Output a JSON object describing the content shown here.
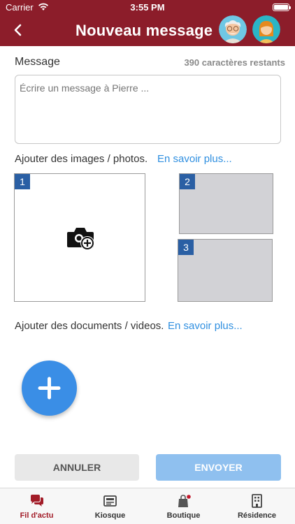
{
  "status_bar": {
    "carrier": "Carrier",
    "time": "3:55 PM"
  },
  "header": {
    "title": "Nouveau message",
    "back_icon": "chevron-left-icon",
    "background": "#8c1d2a"
  },
  "message": {
    "label": "Message",
    "chars_remaining": "390 caractères restants",
    "placeholder": "Écrire un message à Pierre ..."
  },
  "images": {
    "label": "Ajouter des images / photos.",
    "link": "En savoir plus...",
    "slots": [
      "1",
      "2",
      "3"
    ]
  },
  "documents": {
    "label": "Ajouter des documents / videos.",
    "link": "En savoir plus..."
  },
  "actions": {
    "cancel": "ANNULER",
    "send": "ENVOYER"
  },
  "tabs": [
    {
      "label": "Fil d'actu",
      "icon": "chat-bubbles-icon",
      "active": true
    },
    {
      "label": "Kiosque",
      "icon": "newspaper-icon",
      "active": false
    },
    {
      "label": "Boutique",
      "icon": "shopping-bag-icon",
      "active": false
    },
    {
      "label": "Résidence",
      "icon": "building-icon",
      "active": false
    }
  ],
  "colors": {
    "accent": "#8c1d2a",
    "link": "#2f8fe0",
    "fab": "#3a8ee6",
    "send_disabled": "#8fc0ef",
    "slot_badge": "#2a5fa4"
  }
}
